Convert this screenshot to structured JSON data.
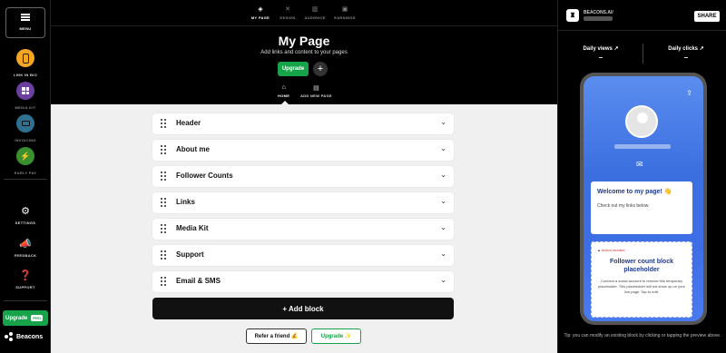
{
  "sidebar": {
    "menu_label": "MENU",
    "items": [
      {
        "label": "LINK IN BIO",
        "icon": "phone-icon",
        "color": "#f5a623"
      },
      {
        "label": "MEDIA KIT",
        "icon": "grid-icon",
        "color": "#6b3fa0"
      },
      {
        "label": "INVOICING",
        "icon": "invoice-icon",
        "color": "#2f6f8f"
      },
      {
        "label": "EARLY PAY",
        "icon": "bolt-icon",
        "color": "#3a8f2f"
      }
    ],
    "settings_label": "SETTINGS",
    "feedback_label": "FEEDBACK",
    "support_label": "SUPPORT",
    "upgrade_label": "Upgrade",
    "pro_badge": "PRO",
    "brand": "Beacons"
  },
  "topbar": {
    "tabs": [
      {
        "label": "MY PAGE",
        "icon": "layers-icon"
      },
      {
        "label": "DESIGN",
        "icon": "design-icon"
      },
      {
        "label": "AUDIENCE",
        "icon": "chart-icon"
      },
      {
        "label": "EARNINGS",
        "icon": "earnings-icon"
      }
    ],
    "title": "My Page",
    "subtitle": "Add links and content to your pages",
    "upgrade_label": "Upgrade",
    "plus_label": "+",
    "sub_tabs": [
      {
        "label": "HOME",
        "icon": "home-icon"
      },
      {
        "label": "ADD NEW PAGE",
        "icon": "add-page-icon"
      }
    ]
  },
  "blocks": [
    "Header",
    "About me",
    "Follower Counts",
    "Links",
    "Media Kit",
    "Support",
    "Email & SMS"
  ],
  "add_block_label": "+ Add block",
  "refer_label": "Refer a friend 💰",
  "upgrade_bottom_label": "Upgrade ✨",
  "right_panel": {
    "account_name": "BEACONS.AI/",
    "share_label": "SHARE",
    "daily_views_label": "Daily views ↗",
    "daily_views_value": "–",
    "daily_clicks_label": "Daily clicks ↗",
    "daily_clicks_value": "–",
    "preview": {
      "welcome_title": "Welcome to my page! 👋",
      "welcome_sub": "Check out my links below.",
      "warning": "▲ Action needed",
      "fc_title": "Follower count block placeholder",
      "fc_body": "Connect a social account to remove this temporary placeholder. This placeholder will not show up on your live page. Tap to edit."
    },
    "tip": "Tip: you can modify an existing block by clicking or tapping the preview above."
  }
}
